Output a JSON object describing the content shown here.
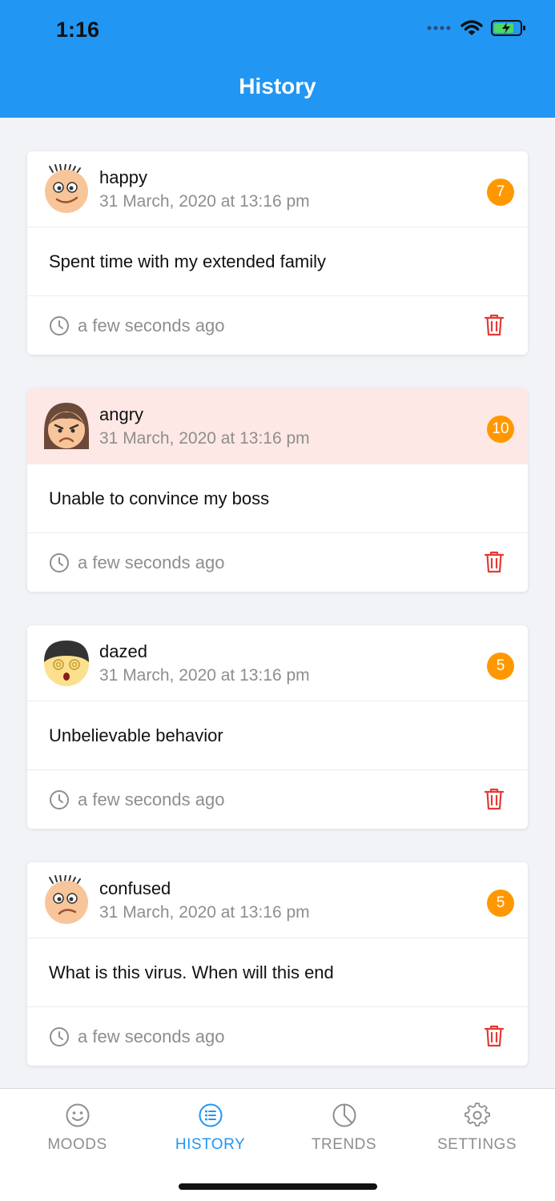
{
  "status_bar": {
    "time": "1:16"
  },
  "header": {
    "title": "History"
  },
  "entries": [
    {
      "mood": "happy",
      "date": "31 March, 2020 at 13:16 pm",
      "score": "7",
      "note": "Spent time with my extended family",
      "ago": "a few seconds ago"
    },
    {
      "mood": "angry",
      "date": "31 March, 2020 at 13:16 pm",
      "score": "10",
      "note": "Unable to convince my boss",
      "ago": "a few seconds ago"
    },
    {
      "mood": "dazed",
      "date": "31 March, 2020 at 13:16 pm",
      "score": "5",
      "note": "Unbelievable behavior",
      "ago": "a few seconds ago"
    },
    {
      "mood": "confused",
      "date": "31 March, 2020 at 13:16 pm",
      "score": "5",
      "note": "What is this virus. When will this end",
      "ago": "a few seconds ago"
    }
  ],
  "tabs": [
    {
      "label": "MOODS",
      "icon": "smile-icon"
    },
    {
      "label": "HISTORY",
      "icon": "list-icon",
      "active": true
    },
    {
      "label": "TRENDS",
      "icon": "pie-chart-icon"
    },
    {
      "label": "SETTINGS",
      "icon": "gear-icon"
    }
  ],
  "colors": {
    "primary": "#2196F3",
    "badge": "#FF9800",
    "danger": "#E53935",
    "angry_highlight": "#FDE8E5"
  }
}
